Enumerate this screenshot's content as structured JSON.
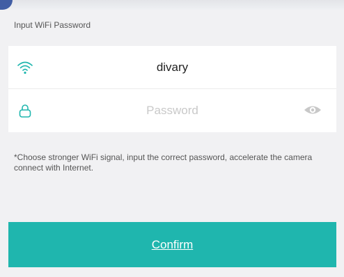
{
  "section": {
    "title": "Input WiFi Password"
  },
  "network": {
    "ssid": "divary",
    "icon": "wifi-icon"
  },
  "password": {
    "value": "",
    "placeholder": "Password",
    "icon": "lock-icon",
    "toggle_icon": "eye-icon"
  },
  "hint": {
    "text": "*Choose stronger WiFi signal, input the correct password, accelerate the camera connect with Internet."
  },
  "actions": {
    "confirm_label": "Confirm"
  },
  "colors": {
    "accent": "#1fb6ae",
    "background": "#f1f1f3",
    "card": "#ffffff",
    "placeholder": "#c9c9c9"
  }
}
